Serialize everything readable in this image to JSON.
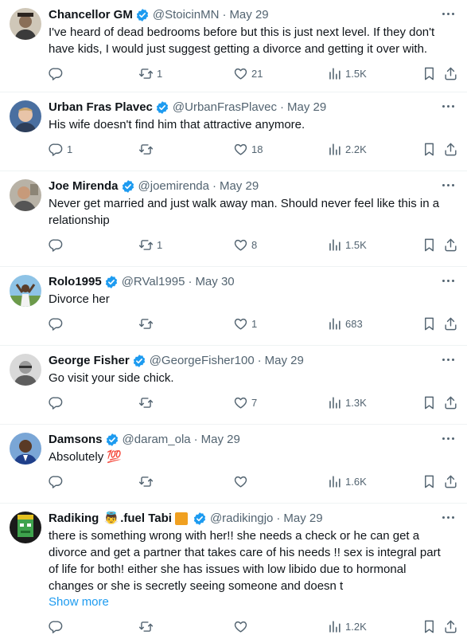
{
  "tweets": [
    {
      "name": "Chancellor GM",
      "handle": "@StoicinMN",
      "date": "May 29",
      "text": "I've heard of dead bedrooms before but this is just next level. If they don't have kids, I would just suggest getting a divorce and getting it over with.",
      "replies": "",
      "retweets": "1",
      "likes": "21",
      "views": "1.5K"
    },
    {
      "name": "Urban Fras Plavec",
      "handle": "@UrbanFrasPlavec",
      "date": "May 29",
      "text": "His wife doesn't find him that attractive anymore.",
      "replies": "1",
      "retweets": "",
      "likes": "18",
      "views": "2.2K"
    },
    {
      "name": "Joe Mirenda",
      "handle": "@joemirenda",
      "date": "May 29",
      "text": "Never get married and just walk away man. Should never feel like this in a relationship",
      "replies": "",
      "retweets": "1",
      "likes": "8",
      "views": "1.5K"
    },
    {
      "name": "Rolo1995",
      "handle": "@RVal1995",
      "date": "May 30",
      "text": "Divorce her",
      "replies": "",
      "retweets": "",
      "likes": "1",
      "views": "683"
    },
    {
      "name": "George Fisher",
      "handle": "@GeorgeFisher100",
      "date": "May 29",
      "text": "Go visit your side chick.",
      "replies": "",
      "retweets": "",
      "likes": "7",
      "views": "1.3K"
    },
    {
      "name": "Damsons",
      "handle": "@daram_ola",
      "date": "May 29",
      "text": "Absolutely",
      "text_emoji": "💯",
      "replies": "",
      "retweets": "",
      "likes": "",
      "views": "1.6K"
    },
    {
      "name_part1": "Radiking",
      "name_emoji": "👼",
      "name_part2": ".fuel Tabi",
      "handle": "@radikingjo",
      "date": "May 29",
      "text": "there is something wrong with her!! she needs a check or he can get a divorce and get a partner that takes care of his needs !! sex is integral part of life for both! either she has issues with low libido due to hormonal changes or she is secretly seeing someone and doesn t",
      "show_more": "Show more",
      "replies": "",
      "retweets": "",
      "likes": "",
      "views": "1.2K"
    }
  ],
  "colors": {
    "text": "#0f1419",
    "muted": "#536471",
    "accent": "#1d9bf0",
    "divider": "#eff3f4"
  },
  "icons": [
    "reply-icon",
    "retweet-icon",
    "like-icon",
    "views-icon",
    "bookmark-icon",
    "share-icon",
    "verified-badge-icon",
    "more-icon"
  ]
}
